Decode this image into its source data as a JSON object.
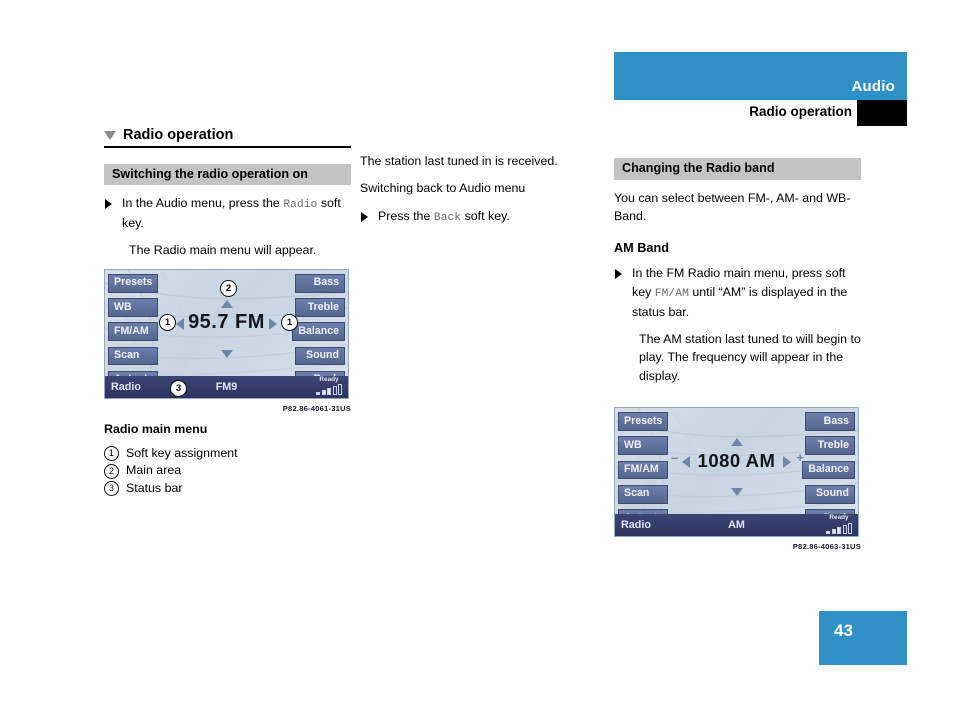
{
  "header": {
    "band_label": "Audio",
    "sub_label": "Radio operation"
  },
  "page": {
    "number": "43"
  },
  "left_column": {
    "section_title": "Radio operation",
    "subhead": "Switching the radio operation on",
    "bullet1_pre": "In the Audio menu, press the ",
    "bullet1_mono": "Radio",
    "bullet1_post": " soft key.",
    "para1": "The Radio main menu will appear.",
    "figure_code": "P82.86-4061-31US",
    "caption_title": "Radio main menu",
    "legend": [
      {
        "num": "1",
        "label": "Soft key assignment"
      },
      {
        "num": "2",
        "label": "Main area"
      },
      {
        "num": "3",
        "label": "Status bar"
      }
    ],
    "display": {
      "soft_keys_left": [
        "Presets",
        "WB",
        "FM/AM",
        "Scan",
        "Autost."
      ],
      "soft_keys_right": [
        "Bass",
        "Treble",
        "Balance",
        "Sound",
        "Back"
      ],
      "frequency": "95.7 FM",
      "minus": "–",
      "plus": "+",
      "status_left": "Radio",
      "status_center": "FM9",
      "signal_label": "Ready",
      "callouts": [
        "1",
        "2",
        "1",
        "3"
      ]
    }
  },
  "mid_column": {
    "para1": "The station last tuned in is received.",
    "para2": "Switching back to Audio menu",
    "bullet1_pre": "Press the ",
    "bullet1_mono": "Back",
    "bullet1_post": " soft key."
  },
  "right_column": {
    "subhead": "Changing the Radio band",
    "para1": "You can select between FM-, AM- and WB-Band.",
    "heading2": "AM Band",
    "bullet1_pre": "In the FM Radio main menu, press soft key ",
    "bullet1_mono": "FM/AM",
    "bullet1_post": " until “AM” is displayed in the status bar.",
    "para2": "The AM station last tuned to will begin to play. The frequency will appear in the display.",
    "figure_code": "P82.86-4063-31US",
    "display": {
      "soft_keys_left": [
        "Presets",
        "WB",
        "FM/AM",
        "Scan",
        "Autost."
      ],
      "soft_keys_right": [
        "Bass",
        "Treble",
        "Balance",
        "Sound",
        "Back"
      ],
      "frequency": "1080 AM",
      "minus": "–",
      "plus": "+",
      "status_left": "Radio",
      "status_center": "AM",
      "signal_label": "Ready"
    }
  },
  "colors": {
    "brand_blue": "#2f91c8",
    "subhead_gray": "#c3c3c3",
    "display_key": "#5f709c",
    "status_navy": "#2c3460"
  }
}
